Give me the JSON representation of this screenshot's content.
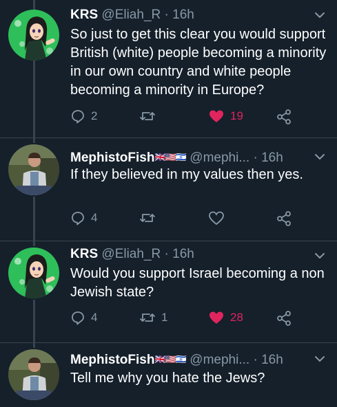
{
  "colors": {
    "background": "#15202b",
    "muted": "#8899a6",
    "like_active": "#e0245e",
    "divider": "#38444d"
  },
  "tweets": [
    {
      "name": "KRS",
      "handle": "@Eliah_R",
      "dot": "·",
      "time": "16h",
      "flags": "",
      "text": "So just to get this clear you would support British (white) people becoming a minority in our own country and white people becoming a minority in Europe?",
      "reply_count": "2",
      "retweet_count": "",
      "like_count": "19",
      "liked": true,
      "avatar": "anime-girl-avatar"
    },
    {
      "name": "MephistoFish",
      "handle": "@mephi...",
      "dot": "·",
      "time": "16h",
      "flags": "🇬🇧🇺🇸🇮🇱",
      "text": "If they believed in my values then yes.",
      "reply_count": "4",
      "retweet_count": "",
      "like_count": "",
      "liked": false,
      "avatar": "person-photo-avatar"
    },
    {
      "name": "KRS",
      "handle": "@Eliah_R",
      "dot": "·",
      "time": "16h",
      "flags": "",
      "text": "Would you support Israel becoming a non Jewish state?",
      "reply_count": "4",
      "retweet_count": "1",
      "like_count": "28",
      "liked": true,
      "avatar": "anime-girl-avatar"
    },
    {
      "name": "MephistoFish",
      "handle": "@mephi...",
      "dot": "·",
      "time": "16h",
      "flags": "🇬🇧🇺🇸🇮🇱",
      "text": "Tell me why you hate the Jews?",
      "avatar": "person-photo-avatar"
    }
  ]
}
